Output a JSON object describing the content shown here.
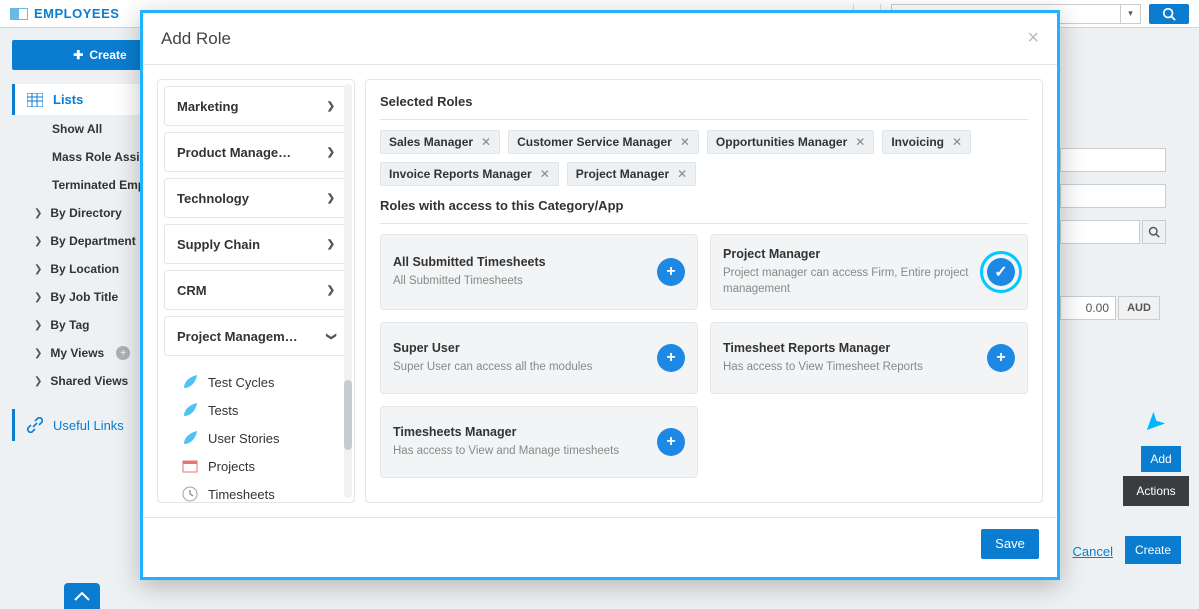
{
  "topbar": {
    "brand": "EMPLOYEES"
  },
  "leftnav": {
    "create": "Create",
    "lists": "Lists",
    "items": [
      {
        "label": "Show All",
        "bold": true
      },
      {
        "label": "Mass Role Assignment",
        "bold": true
      },
      {
        "label": "Terminated Employees",
        "bold": true
      },
      {
        "label": "By Directory",
        "chev": true,
        "bold": true
      },
      {
        "label": "By Department",
        "chev": true,
        "bold": true
      },
      {
        "label": "By Location",
        "chev": true,
        "bold": true
      },
      {
        "label": "By Job Title",
        "chev": true,
        "bold": true
      },
      {
        "label": "By Tag",
        "chev": true,
        "bold": true
      },
      {
        "label": "My Views",
        "chev": true,
        "bold": true,
        "plus": true
      },
      {
        "label": "Shared Views",
        "chev": true,
        "bold": true
      }
    ],
    "useful": "Useful Links"
  },
  "rightpane": {
    "amount": "0.00",
    "currency": "AUD",
    "add": "Add",
    "actions": "Actions",
    "cancel": "Cancel",
    "create": "Create"
  },
  "modal": {
    "title": "Add Role",
    "save": "Save",
    "categories": [
      {
        "label": "Marketing"
      },
      {
        "label": "Product Manage…"
      },
      {
        "label": "Technology"
      },
      {
        "label": "Supply Chain"
      },
      {
        "label": "CRM"
      },
      {
        "label": "Project Managem…",
        "expanded": true,
        "subs": [
          {
            "label": "Test Cycles",
            "icon": "leaf"
          },
          {
            "label": "Tests",
            "icon": "leaf"
          },
          {
            "label": "User Stories",
            "icon": "leaf"
          },
          {
            "label": "Projects",
            "icon": "proj"
          },
          {
            "label": "Timesheets",
            "icon": "clock"
          }
        ]
      }
    ],
    "selected_title": "Selected Roles",
    "selected_roles": [
      "Sales Manager",
      "Customer Service Manager",
      "Opportunities Manager",
      "Invoicing",
      "Invoice Reports Manager",
      "Project Manager"
    ],
    "access_title": "Roles with access to this Category/App",
    "role_cards": [
      {
        "title": "All Submitted Timesheets",
        "desc": "All Submitted Timesheets",
        "state": "add"
      },
      {
        "title": "Project Manager",
        "desc": "Project manager can access Firm, Entire project management",
        "state": "sel"
      },
      {
        "title": "Super User",
        "desc": "Super User can access all the modules",
        "state": "add"
      },
      {
        "title": "Timesheet Reports Manager",
        "desc": "Has access to View Timesheet Reports",
        "state": "add"
      },
      {
        "title": "Timesheets Manager",
        "desc": "Has access to View and Manage timesheets",
        "state": "add"
      }
    ]
  }
}
